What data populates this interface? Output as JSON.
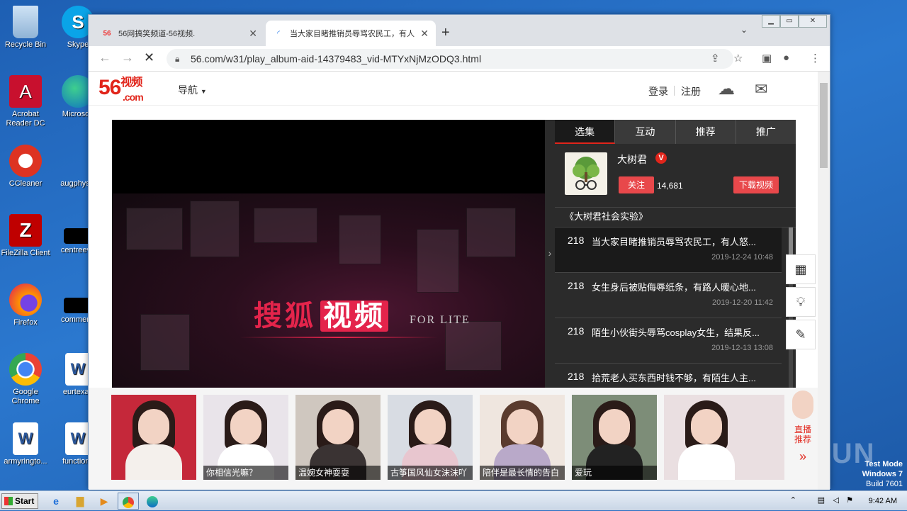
{
  "desktop": {
    "icons": [
      {
        "label": "Recycle Bin",
        "icon": "recycle-bin-icon"
      },
      {
        "label": "Skype",
        "icon": "skype-icon"
      },
      {
        "label": "Acrobat Reader DC",
        "icon": "acrobat-icon"
      },
      {
        "label": "Microsoft",
        "icon": "edge-icon"
      },
      {
        "label": "CCleaner",
        "icon": "ccleaner-icon"
      },
      {
        "label": "augphysic",
        "icon": "file-icon"
      },
      {
        "label": "FileZilla Client",
        "icon": "filezilla-icon"
      },
      {
        "label": "centreeve",
        "icon": "file-icon"
      },
      {
        "label": "Firefox",
        "icon": "firefox-icon"
      },
      {
        "label": "commentl",
        "icon": "file-icon"
      },
      {
        "label": "Google Chrome",
        "icon": "chrome-icon"
      },
      {
        "label": "eurtexas",
        "icon": "word-icon"
      },
      {
        "label": "armyringto...",
        "icon": "word-icon"
      },
      {
        "label": "functions",
        "icon": "word-icon"
      }
    ]
  },
  "browser": {
    "tabs": [
      {
        "title": "56网搞笑频道-56视频.",
        "favicon": "56",
        "active": false
      },
      {
        "title": "当大家目睹推销员辱骂农民工，有人",
        "favicon": "loading",
        "active": true
      }
    ],
    "url": "56.com/w31/play_album-aid-14379483_vid-MTYxNjMzODQ3.html"
  },
  "site": {
    "logo_main": "56",
    "logo_sub": "视频",
    "logo_com": ".com",
    "nav_label": "导航",
    "login": "登录",
    "register": "注册"
  },
  "player": {
    "brand_text": "搜狐",
    "brand_highlight": "视频",
    "overlay_text": "FOR LITE"
  },
  "panel": {
    "tabs": [
      "选集",
      "互动",
      "推荐",
      "推广"
    ],
    "creator_name": "大树君",
    "verified": "V",
    "follow_label": "关注",
    "fans": "14,681",
    "download_label": "下载视频",
    "album_title": "《大树君社会实验》",
    "episodes": [
      {
        "num": "218",
        "title": "当大家目睹推销员辱骂农民工，有人怒...",
        "date": "2019-12-24 10:48"
      },
      {
        "num": "218",
        "title": "女生身后被贴侮辱纸条，有路人暖心地...",
        "date": "2019-12-20 11:42"
      },
      {
        "num": "218",
        "title": "陌生小伙街头辱骂cosplay女生，结果反...",
        "date": "2019-12-13 13:08"
      },
      {
        "num": "218",
        "title": "拾荒老人买东西时钱不够，有陌生人主...",
        "date": ""
      }
    ]
  },
  "thumbs": [
    {
      "caption": ""
    },
    {
      "caption": "你相信光嘛？"
    },
    {
      "caption": "温婉女神耍耍"
    },
    {
      "caption": "古筝国风仙女沫沫吖"
    },
    {
      "caption": "陪伴是最长情的告白"
    },
    {
      "caption": "爱玩"
    },
    {
      "caption": ""
    }
  ],
  "live_ad": {
    "line1": "直播",
    "line2": "推荐",
    "more": "»"
  },
  "watermark": "ANY RUN",
  "testmode": {
    "line1": "Test Mode",
    "line2": "Windows 7",
    "line3": "Build 7601"
  },
  "taskbar": {
    "start": "Start",
    "time": "9:42 AM"
  }
}
